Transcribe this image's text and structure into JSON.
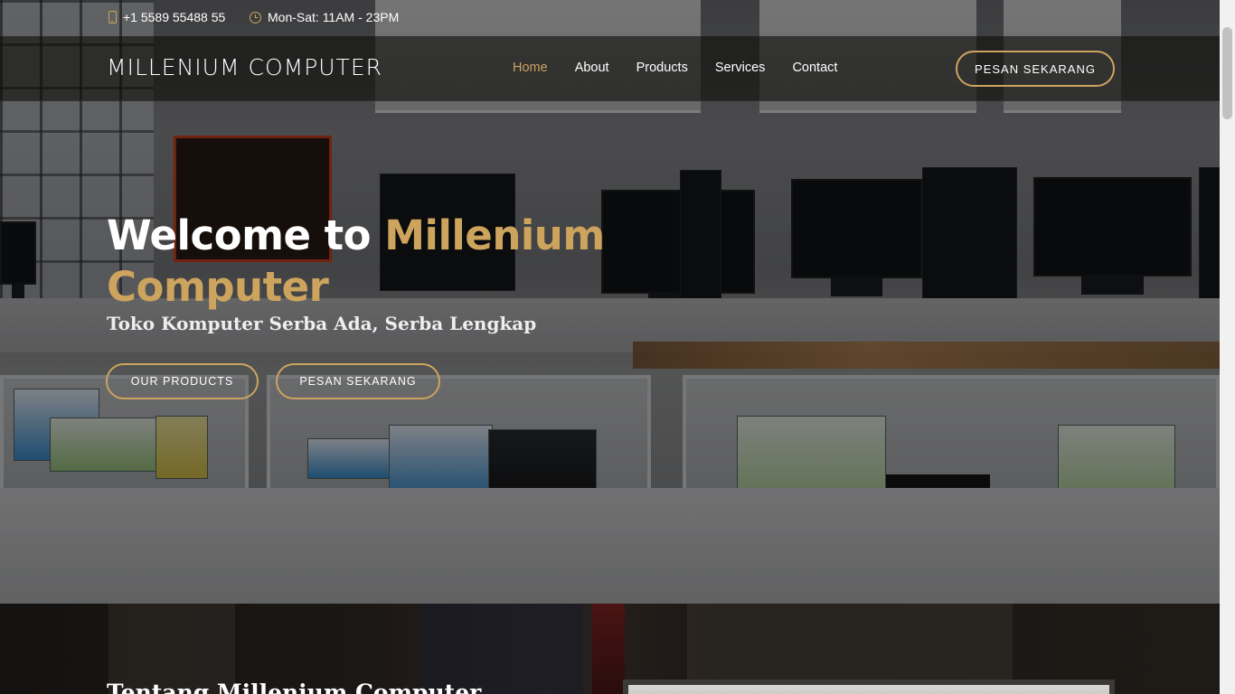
{
  "topbar": {
    "phone": "+1 5589 55488 55",
    "hours": "Mon-Sat: 11AM - 23PM",
    "phone_icon": "phone-icon",
    "hours_icon": "clock-icon"
  },
  "navbar": {
    "logo": "MILLENIUM COMPUTER",
    "items": [
      {
        "label": "Home",
        "active": true
      },
      {
        "label": "About",
        "active": false
      },
      {
        "label": "Products",
        "active": false
      },
      {
        "label": "Services",
        "active": false
      },
      {
        "label": "Contact",
        "active": false
      }
    ],
    "cta": "PESAN SEKARANG"
  },
  "hero": {
    "title_white": "Welcome to ",
    "title_gold": "Millenium Computer",
    "subtitle": "Toko Komputer Serba Ada, Serba Lengkap",
    "btn_products": "OUR PRODUCTS",
    "btn_order": "PESAN SEKARANG"
  },
  "about": {
    "title": "Tentang Millenium Computer"
  },
  "colors": {
    "accent": "#cda45e",
    "navbar_bg": "#0c0b09",
    "text": "#ffffff"
  }
}
